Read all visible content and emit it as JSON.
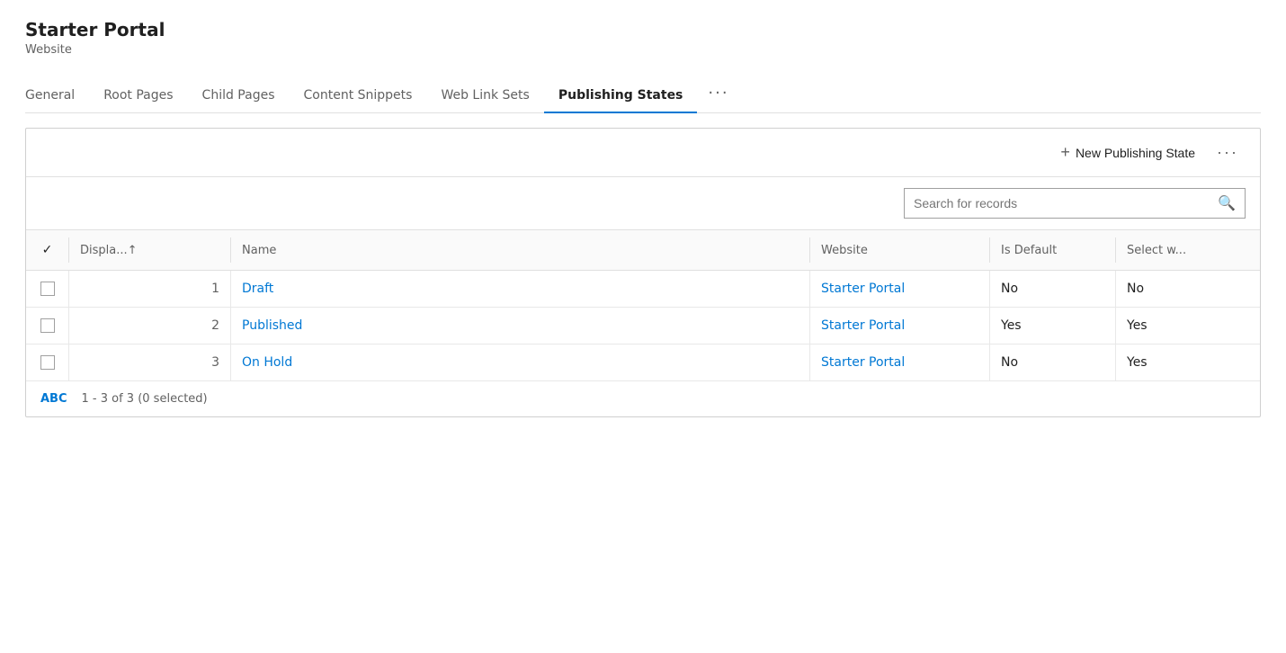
{
  "header": {
    "title": "Starter Portal",
    "subtitle": "Website"
  },
  "tabs": [
    {
      "id": "general",
      "label": "General",
      "active": false
    },
    {
      "id": "root-pages",
      "label": "Root Pages",
      "active": false
    },
    {
      "id": "child-pages",
      "label": "Child Pages",
      "active": false
    },
    {
      "id": "content-snippets",
      "label": "Content Snippets",
      "active": false
    },
    {
      "id": "web-link-sets",
      "label": "Web Link Sets",
      "active": false
    },
    {
      "id": "publishing-states",
      "label": "Publishing States",
      "active": true
    }
  ],
  "toolbar": {
    "new_button_label": "New Publishing State",
    "more_icon": "···"
  },
  "search": {
    "placeholder": "Search for records"
  },
  "table": {
    "columns": [
      {
        "id": "check",
        "label": "✓"
      },
      {
        "id": "display",
        "label": "Displa...↑"
      },
      {
        "id": "name",
        "label": "Name"
      },
      {
        "id": "website",
        "label": "Website"
      },
      {
        "id": "is_default",
        "label": "Is Default"
      },
      {
        "id": "select_w",
        "label": "Select w..."
      }
    ],
    "rows": [
      {
        "id": 1,
        "display": "1",
        "name": "Draft",
        "website": "Starter Portal",
        "is_default": "No",
        "select_w": "No"
      },
      {
        "id": 2,
        "display": "2",
        "name": "Published",
        "website": "Starter Portal",
        "is_default": "Yes",
        "select_w": "Yes"
      },
      {
        "id": 3,
        "display": "3",
        "name": "On Hold",
        "website": "Starter Portal",
        "is_default": "No",
        "select_w": "Yes"
      }
    ]
  },
  "footer": {
    "abc_label": "ABC",
    "count_label": "1 - 3 of 3 (0 selected)"
  },
  "colors": {
    "active_tab_underline": "#0078d4",
    "link_color": "#0078d4"
  }
}
